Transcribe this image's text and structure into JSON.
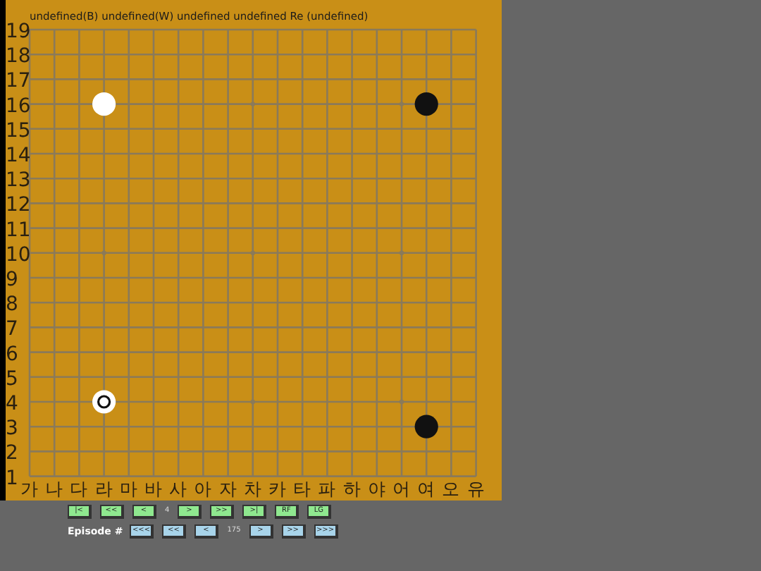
{
  "board": {
    "header": "undefined(B) undefined(W) undefined undefined Re (undefined)",
    "row_labels": [
      "19",
      "18",
      "17",
      "16",
      "15",
      "14",
      "13",
      "12",
      "11",
      "10",
      "9",
      "8",
      "7",
      "6",
      "5",
      "4",
      "3",
      "2",
      "1"
    ],
    "column_labels": [
      "가",
      "나",
      "다",
      "라",
      "마",
      "바",
      "사",
      "아",
      "자",
      "차",
      "카",
      "타",
      "파",
      "하",
      "야",
      "어",
      "여",
      "오",
      "유"
    ],
    "stones": [
      {
        "kind": "white",
        "last_move": false
      },
      {
        "kind": "black",
        "last_move": false
      },
      {
        "kind": "white",
        "last_move": true
      },
      {
        "kind": "black",
        "last_move": false
      }
    ]
  },
  "move_controls": [
    {
      "kind": "button",
      "label": "|<"
    },
    {
      "kind": "button",
      "label": "<<"
    },
    {
      "kind": "button",
      "label": "<"
    },
    {
      "kind": "text",
      "label": "4"
    },
    {
      "kind": "button",
      "label": ">"
    },
    {
      "kind": "button",
      "label": ">>"
    },
    {
      "kind": "button",
      "label": ">|"
    },
    {
      "kind": "button",
      "label": "RF"
    },
    {
      "kind": "button",
      "label": "LG"
    }
  ],
  "episode_controls": [
    {
      "kind": "label",
      "label": "Episode #"
    },
    {
      "kind": "button",
      "label": "<<<"
    },
    {
      "kind": "button",
      "label": "<<"
    },
    {
      "kind": "button",
      "label": "<"
    },
    {
      "kind": "text",
      "label": "175"
    },
    {
      "kind": "button",
      "label": ">"
    },
    {
      "kind": "button",
      "label": ">>"
    },
    {
      "kind": "button",
      "label": ">>>"
    }
  ]
}
